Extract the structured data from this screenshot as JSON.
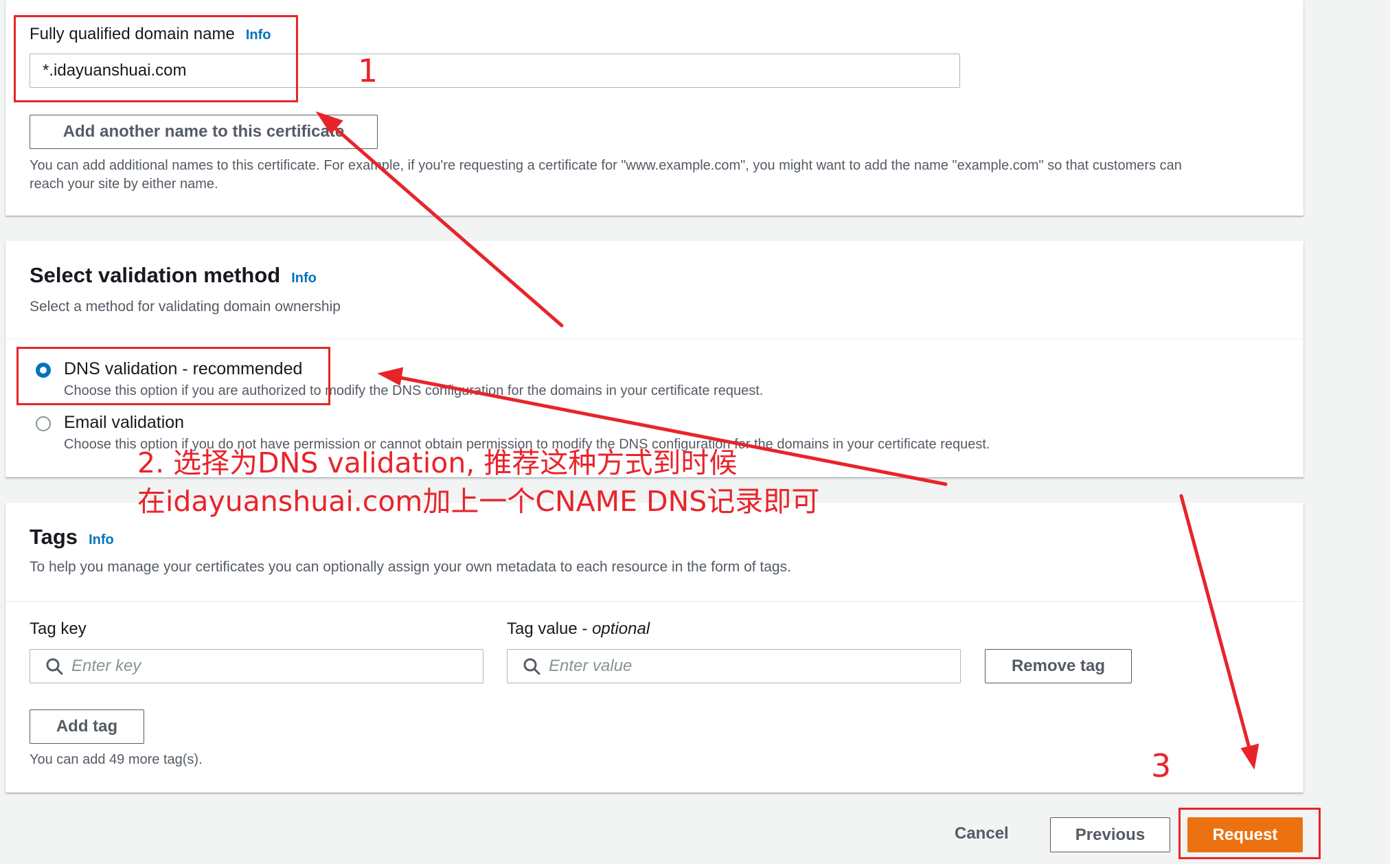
{
  "domain_section": {
    "fqdn_label": "Fully qualified domain name",
    "info_label": "Info",
    "fqdn_value": "*.idayuanshuai.com",
    "add_name_button": "Add another name to this certificate",
    "add_name_help_line1": "You can add additional names to this certificate. For example, if you're requesting a certificate for \"www.example.com\", you might want to add the name \"example.com\" so that customers can",
    "add_name_help_line2": "reach your site by either name."
  },
  "validation_section": {
    "title": "Select validation method",
    "info_label": "Info",
    "subtitle": "Select a method for validating domain ownership",
    "options": [
      {
        "label": "DNS validation - recommended",
        "description": "Choose this option if you are authorized to modify the DNS configuration for the domains in your certificate request.",
        "selected": true
      },
      {
        "label": "Email validation",
        "description": "Choose this option if you do not have permission or cannot obtain permission to modify the DNS configuration for the domains in your certificate request.",
        "selected": false
      }
    ]
  },
  "tags_section": {
    "title": "Tags",
    "info_label": "Info",
    "subtitle": "To help you manage your certificates you can optionally assign your own metadata to each resource in the form of tags.",
    "tag_key_label": "Tag key",
    "tag_value_label": "Tag value - ",
    "tag_value_optional": "optional",
    "tag_key_placeholder": "Enter key",
    "tag_value_placeholder": "Enter value",
    "remove_tag_button": "Remove tag",
    "add_tag_button": "Add tag",
    "tags_remaining": "You can add 49 more tag(s)."
  },
  "footer": {
    "cancel": "Cancel",
    "previous": "Previous",
    "request": "Request"
  },
  "annotations": {
    "step1": "1",
    "step2_line1": "2. 选择为DNS validation, 推荐这种方式到时候",
    "step2_line2": "在idayuanshuai.com加上一个CNAME DNS记录即可",
    "step3": "3"
  },
  "colors": {
    "primary": "#ec7211",
    "info_link": "#0073bb",
    "annotation_red": "#e8242b",
    "radio_selected": "#0073bb"
  }
}
